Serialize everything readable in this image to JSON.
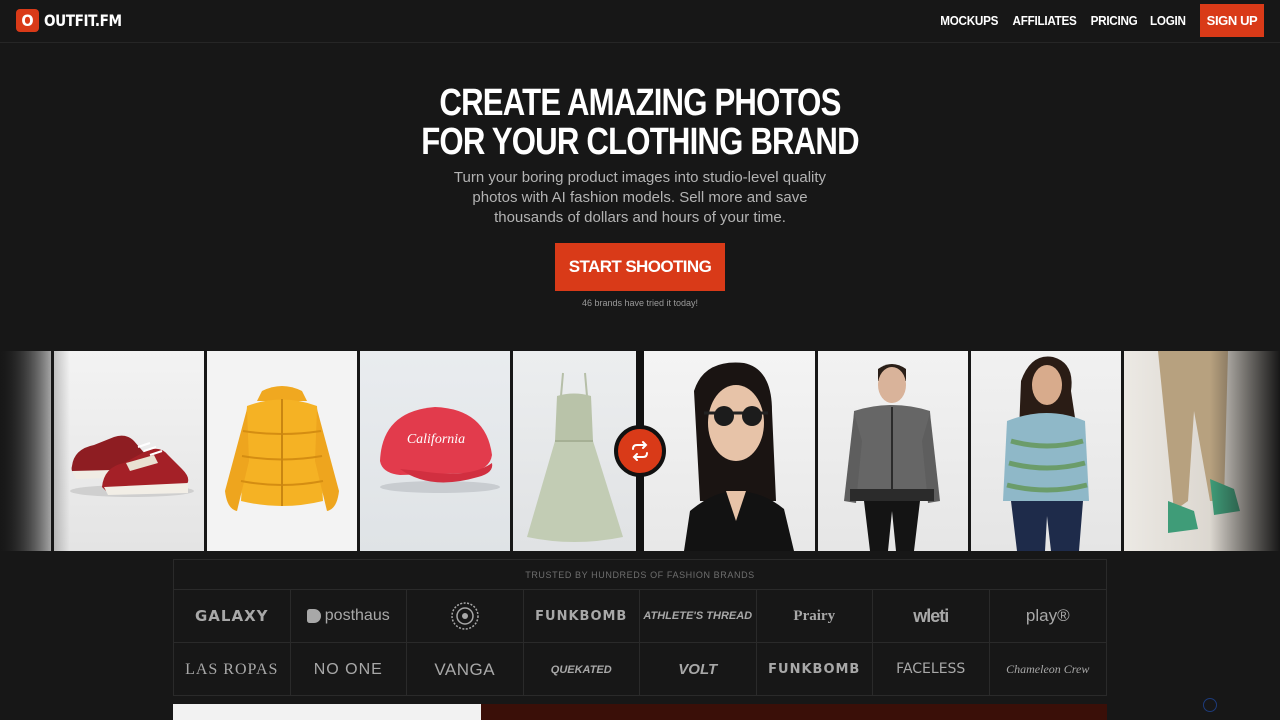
{
  "header": {
    "logo_mark": "O",
    "logo_text": "OUTFIT.FM",
    "nav": [
      "MOCKUPS",
      "AFFILIATES",
      "PRICING",
      "LOGIN"
    ],
    "signup": "SIGN UP"
  },
  "hero": {
    "title_line1": "CREATE AMAZING PHOTOS",
    "title_line2": "FOR YOUR CLOTHING BRAND",
    "subtitle": "Turn your boring product images into studio-level quality photos with AI fashion models. Sell more and save thousands of dollars and hours of your time.",
    "cta": "START SHOOTING",
    "cta_note": "46 brands have tried it today!"
  },
  "gallery": {
    "products": [
      "sneakers",
      "puffer-jacket",
      "red-cap",
      "green-dress"
    ],
    "cap_text": "California",
    "models": [
      "woman-in-blazer",
      "man-in-cardigan",
      "woman-in-sweater",
      "man-in-chinos"
    ]
  },
  "trusted": {
    "title": "TRUSTED BY HUNDREDS OF FASHION BRANDS",
    "brands_row1": [
      "GALAXY",
      "posthaus",
      "",
      "FUNKBOMB",
      "ATHLETE'S THREAD",
      "Prairy",
      "wleti",
      "play®"
    ],
    "brands_row2": [
      "LAS ROPAS",
      "NO ONE",
      "VANGA",
      "QUEKATED",
      "VOLT",
      "FUNKBOMB",
      "FACELESS",
      "Chameleon Crew"
    ]
  },
  "colors": {
    "accent": "#d93a18",
    "background": "#171717"
  }
}
